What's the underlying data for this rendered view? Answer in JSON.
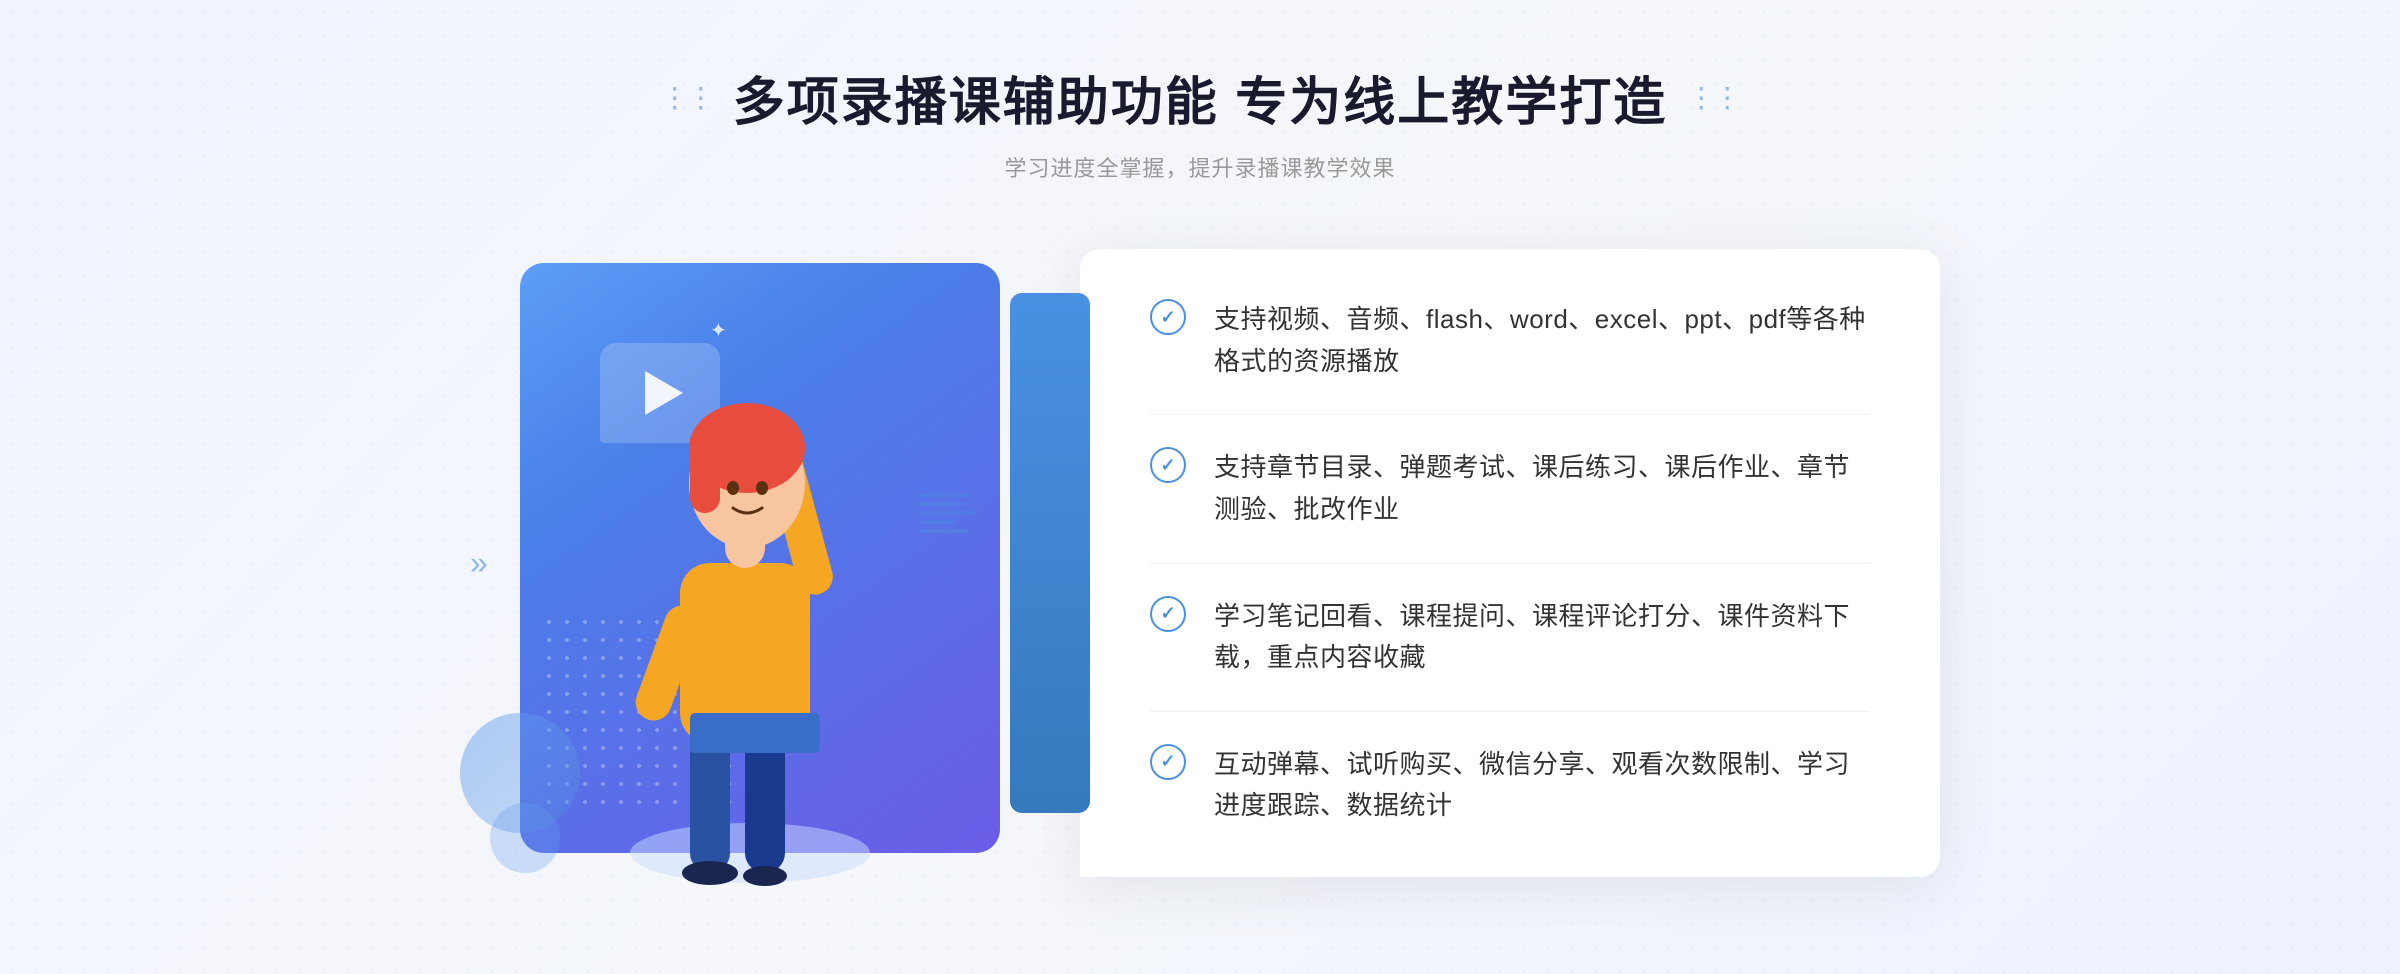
{
  "header": {
    "title": "多项录播课辅助功能 专为线上教学打造",
    "subtitle": "学习进度全掌握，提升录播课教学效果",
    "decorative_dots_left": "⋮⋮",
    "decorative_dots_right": "⋮⋮"
  },
  "features": [
    {
      "id": 1,
      "text": "支持视频、音频、flash、word、excel、ppt、pdf等各种格式的资源播放"
    },
    {
      "id": 2,
      "text": "支持章节目录、弹题考试、课后练习、课后作业、章节测验、批改作业"
    },
    {
      "id": 3,
      "text": "学习笔记回看、课程提问、课程评论打分、课件资料下载，重点内容收藏"
    },
    {
      "id": 4,
      "text": "互动弹幕、试听购买、微信分享、观看次数限制、学习进度跟踪、数据统计"
    }
  ],
  "illustration": {
    "play_button_title": "play button",
    "sparkle_symbol": "✦"
  },
  "colors": {
    "primary_blue": "#4a90e2",
    "gradient_start": "#5b9ef7",
    "gradient_end": "#6b5ce7",
    "text_dark": "#1a1a2e",
    "text_gray": "#999999",
    "text_feature": "#333333",
    "white": "#ffffff"
  }
}
